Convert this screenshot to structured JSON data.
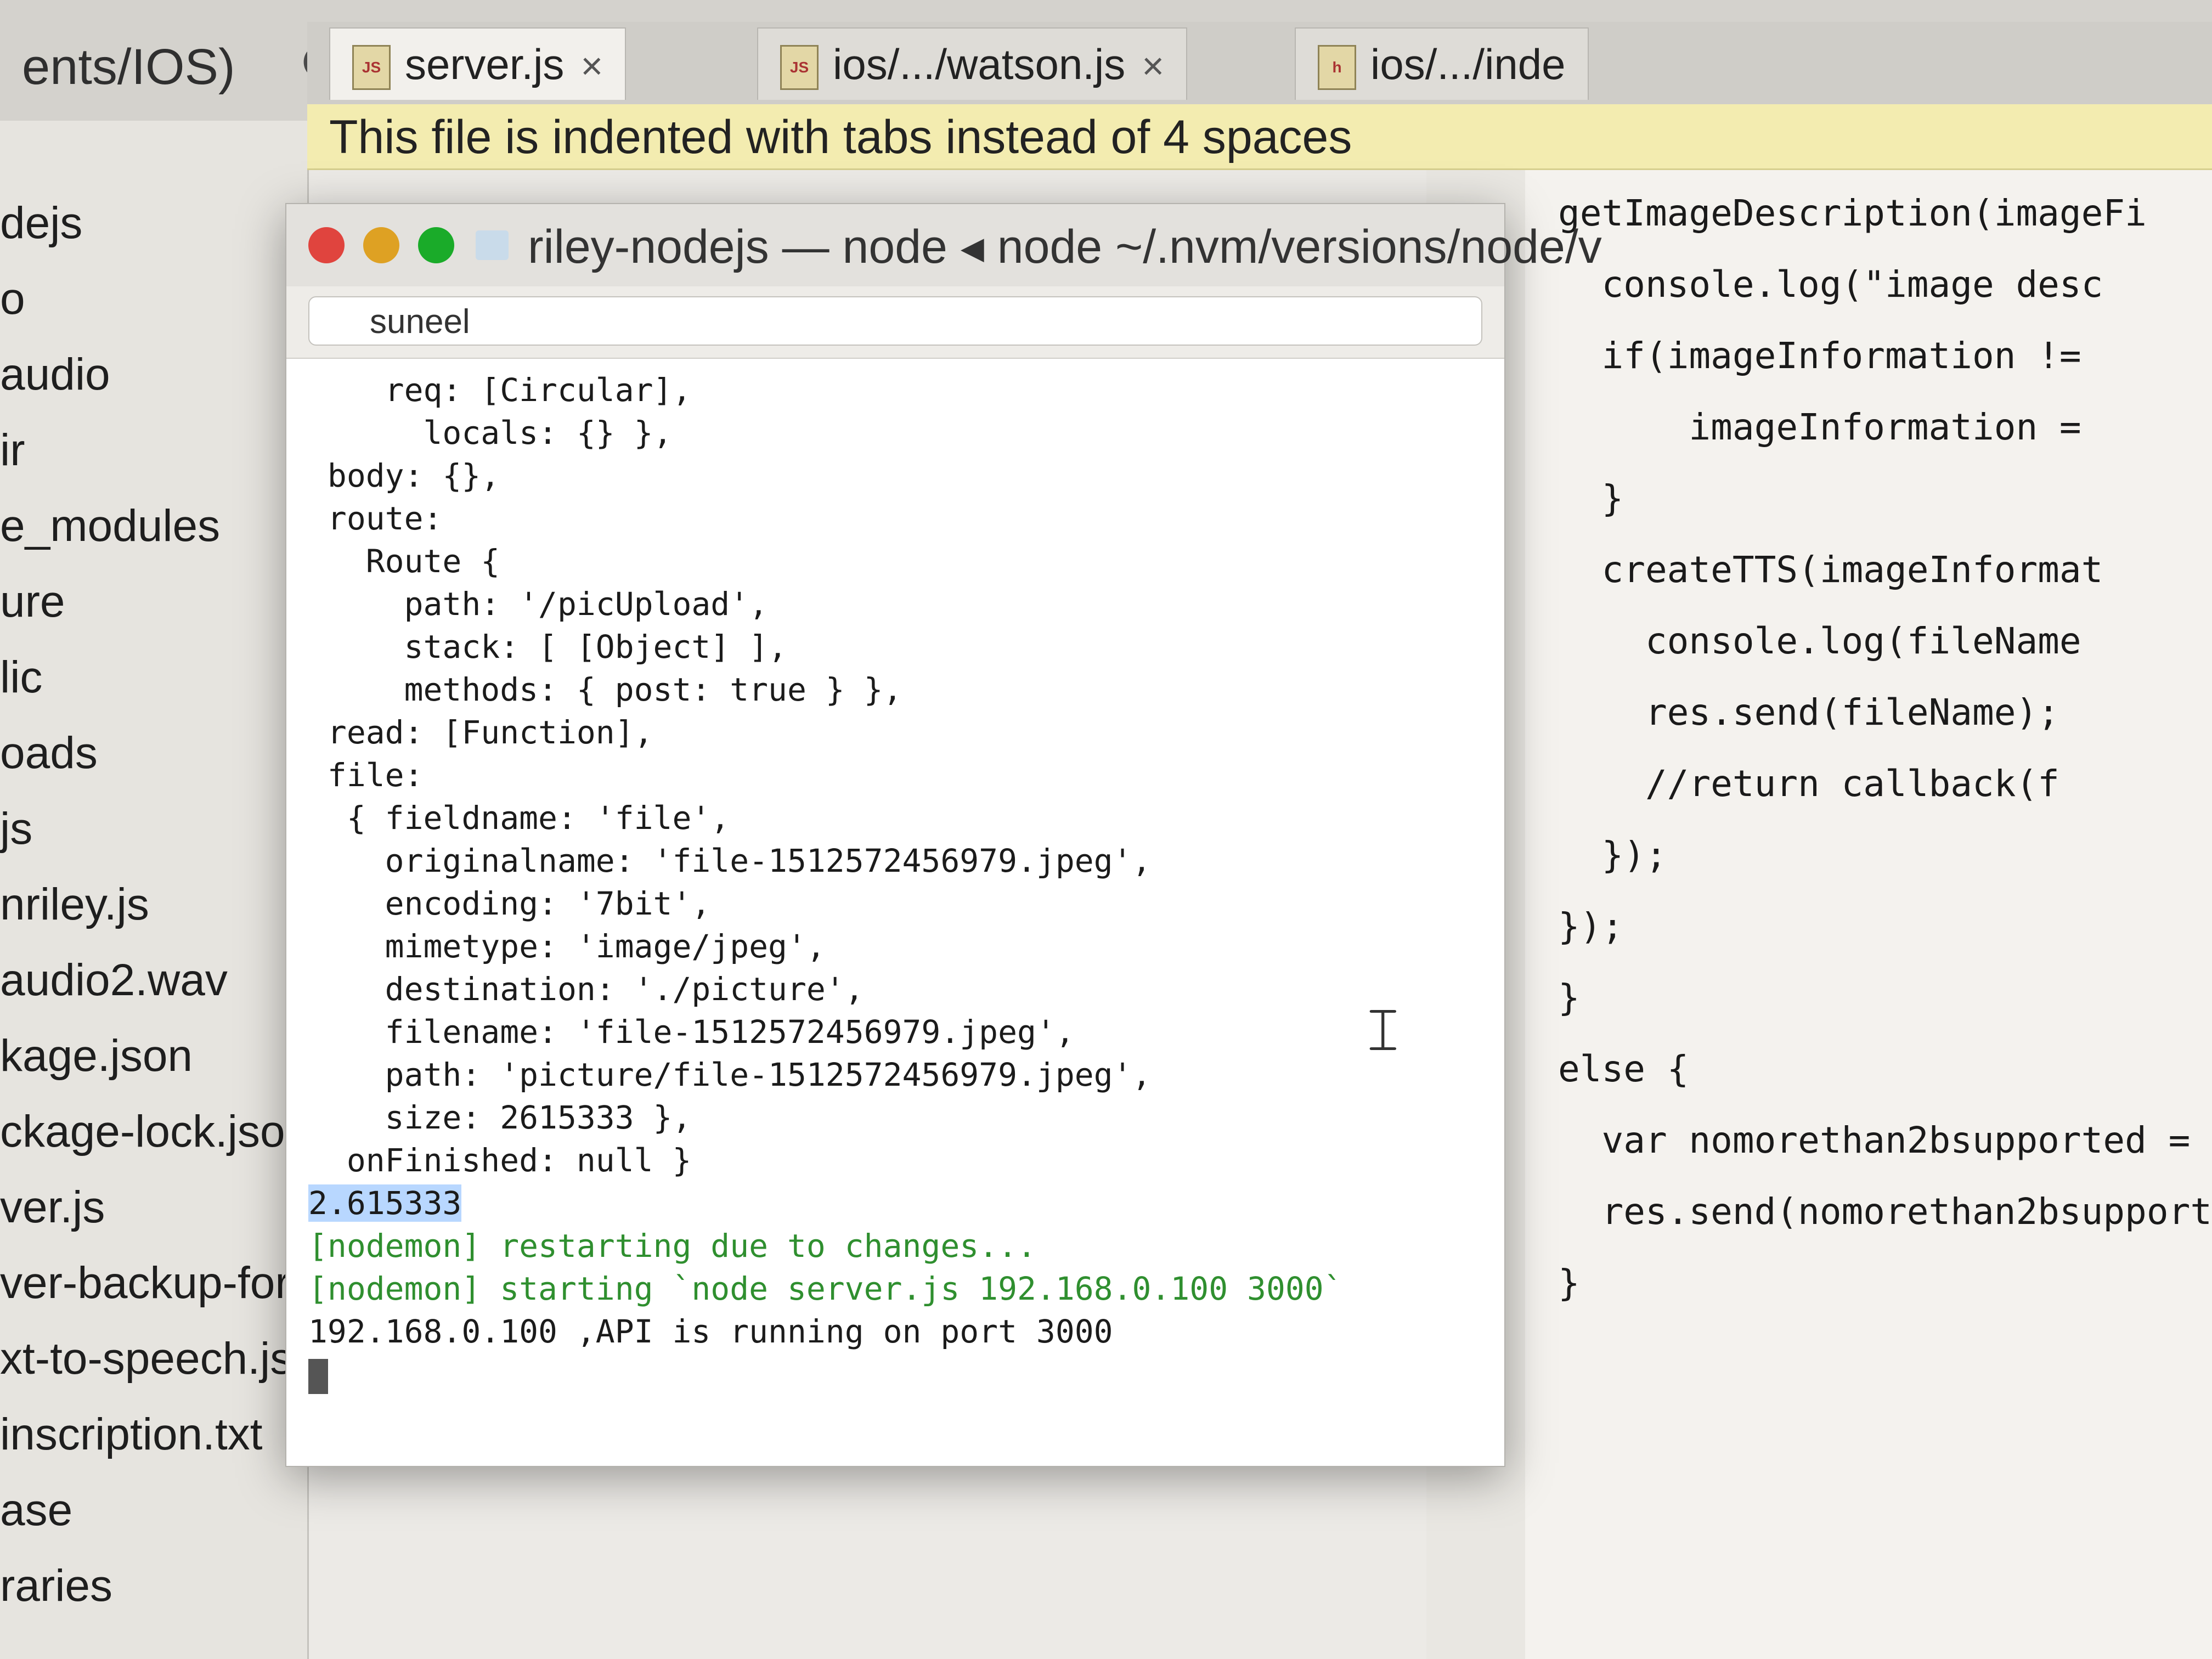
{
  "project": {
    "path": "ents/IOS)"
  },
  "toolbar": {
    "icons": [
      "target-icon",
      "collapse-icon",
      "gear-icon",
      "hide-panel-icon"
    ]
  },
  "sidebar": {
    "items": [
      "dejs",
      "o",
      "audio",
      "ir",
      "e_modules",
      "ure",
      "lic",
      "oads",
      "js",
      "nriley.js",
      "audio2.wav",
      "kage.json",
      "ckage-lock.json",
      "ver.js",
      "ver-backup-for-use",
      "xt-to-speech.js",
      "inscription.txt",
      "ase",
      "raries"
    ]
  },
  "tabs": [
    {
      "label": "server.js",
      "close": "×",
      "active": true
    },
    {
      "label": "ios/.../watson.js",
      "close": "×",
      "active": false
    },
    {
      "label": "ios/.../inde",
      "close": "",
      "active": false
    }
  ],
  "notice": {
    "text": "This file is indented with tabs instead of 4 spaces"
  },
  "terminal": {
    "title": "riley-nodejs — node ◂ node ~/.nvm/versions/node/v",
    "search_value": "suneel",
    "lines": [
      "    req: [Circular],",
      "      locals: {} },",
      " body: {},",
      " route:",
      "   Route {",
      "     path: '/picUpload',",
      "     stack: [ [Object] ],",
      "     methods: { post: true } },",
      " read: [Function],",
      " file:",
      "  { fieldname: 'file',",
      "    originalname: 'file-1512572456979.jpeg',",
      "    encoding: '7bit',",
      "    mimetype: 'image/jpeg',",
      "    destination: './picture',",
      "    filename: 'file-1512572456979.jpeg',",
      "    path: 'picture/file-1512572456979.jpeg',",
      "    size: 2615333 },",
      "  onFinished: null }"
    ],
    "selected_value": "2.615333",
    "nodemon_lines": [
      "[nodemon] restarting due to changes...",
      "[nodemon] starting `node server.js 192.168.0.100 3000`"
    ],
    "final_line": "192.168.0.100 ,API is running on port 3000"
  },
  "editor": {
    "lines": [
      "getImageDescription(imageFi",
      "  console.log(\"image desc",
      "  if(imageInformation !=",
      "      imageInformation =",
      "  }",
      "  createTTS(imageInformat",
      "    console.log(fileName",
      "    res.send(fileName);",
      "    //return callback(f",
      "  });",
      "});",
      "}",
      "else {",
      "  var nomorethan2bsupported =",
      "  res.send(nomorethan2bsupport",
      "}"
    ]
  },
  "colors": {
    "notice_bg": "#f3ecb0",
    "nodemon_green": "#2f8f2f",
    "selection": "#b8d7ff",
    "light_red": "#e0443e",
    "light_yellow": "#dea123",
    "light_green": "#1aab29"
  }
}
